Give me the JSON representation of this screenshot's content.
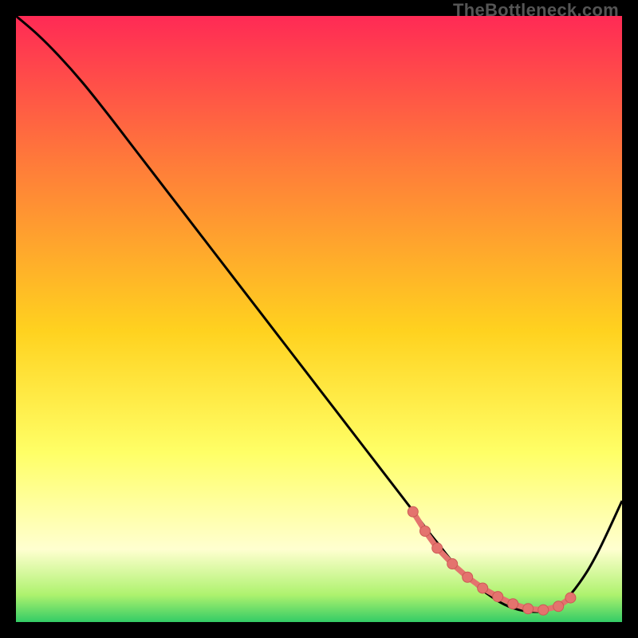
{
  "watermark": "TheBottleneck.com",
  "colors": {
    "gradient_top": "#ff2a55",
    "gradient_mid1": "#ff7a3a",
    "gradient_mid2": "#ffd21f",
    "gradient_mid3": "#ffff66",
    "gradient_mid4": "#ffffd0",
    "gradient_bot1": "#aef26e",
    "gradient_bot2": "#33cc66",
    "curve": "#000000",
    "marker_fill": "#e4736e",
    "marker_stroke": "#cc5a55",
    "frame_bg": "#000000"
  },
  "chart_data": {
    "type": "line",
    "title": "",
    "xlabel": "",
    "ylabel": "",
    "xlim": [
      0,
      100
    ],
    "ylim": [
      0,
      100
    ],
    "grid": false,
    "legend": false,
    "series": [
      {
        "name": "curve",
        "x": [
          0,
          3.5,
          7,
          11,
          15,
          20,
          25,
          30,
          35,
          40,
          45,
          50,
          55,
          60,
          65,
          68,
          70,
          72,
          74,
          76,
          78,
          80,
          82,
          84,
          86,
          88,
          90,
          93,
          96,
          100
        ],
        "y": [
          100,
          97,
          93.5,
          89,
          84,
          77.5,
          71,
          64.5,
          58,
          51.5,
          45,
          38.5,
          32,
          25.5,
          19,
          15,
          12.5,
          10,
          8,
          6,
          4.5,
          3.2,
          2.3,
          1.8,
          1.7,
          2.0,
          3.0,
          6.5,
          11.5,
          20
        ]
      }
    ],
    "markers": {
      "name": "highlight-band",
      "x": [
        65.5,
        67.5,
        69.5,
        72.0,
        74.5,
        77.0,
        79.5,
        82.0,
        84.5,
        87.0,
        89.5,
        91.5
      ],
      "y": [
        18.2,
        15.0,
        12.2,
        9.6,
        7.4,
        5.6,
        4.2,
        3.0,
        2.2,
        2.0,
        2.6,
        4.0
      ]
    }
  }
}
